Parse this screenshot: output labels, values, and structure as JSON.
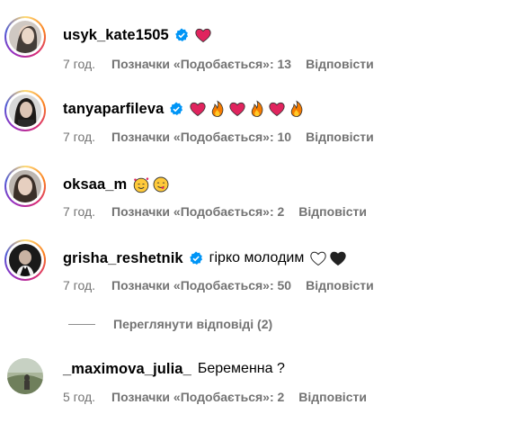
{
  "comments": [
    {
      "username": "usyk_kate1505",
      "verified": true,
      "text": "",
      "emojis": [
        "red-heart"
      ],
      "time": "7 год.",
      "likes": "Позначки «Подобається»: 13",
      "reply": "Відповісти"
    },
    {
      "username": "tanyaparfileva",
      "verified": true,
      "text": "",
      "emojis": [
        "red-heart",
        "fire",
        "red-heart",
        "fire",
        "red-heart",
        "fire"
      ],
      "time": "7 год.",
      "likes": "Позначки «Подобається»: 10",
      "reply": "Відповісти"
    },
    {
      "username": "oksaa_m",
      "verified": false,
      "text": "",
      "emojis": [
        "smiling-face-with-hearts",
        "face-savoring-food"
      ],
      "time": "7 год.",
      "likes": "Позначки «Подобається»: 2",
      "reply": "Відповісти"
    },
    {
      "username": "grisha_reshetnik",
      "verified": true,
      "text": "гірко молодим",
      "emojis": [
        "white-heart",
        "black-heart"
      ],
      "time": "7 год.",
      "likes": "Позначки «Подобається»: 50",
      "reply": "Відповісти"
    },
    {
      "username": "_maximova_julia_",
      "verified": false,
      "text": "Беременна ?",
      "emojis": [],
      "time": "5 год.",
      "likes": "Позначки «Подобається»: 2",
      "reply": "Відповісти"
    }
  ],
  "view_replies": "Переглянути відповіді (2)",
  "colors": {
    "meta": "#737373",
    "verified": "#0095f6",
    "heart": "#e0245e"
  }
}
